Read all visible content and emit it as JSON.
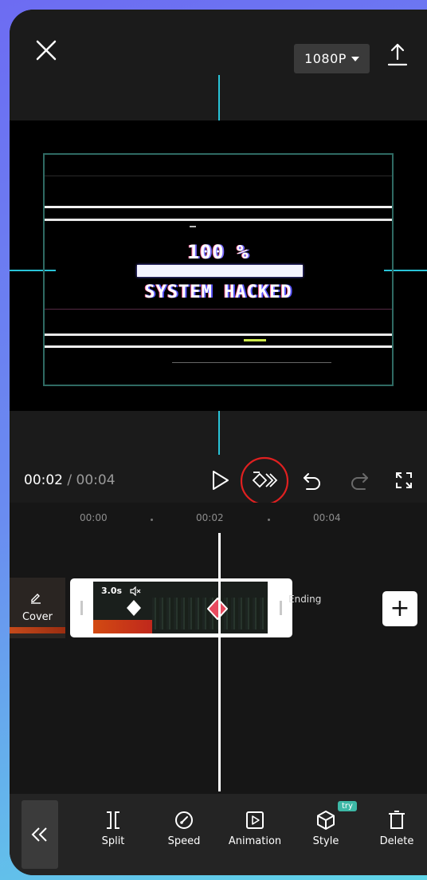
{
  "header": {
    "resolution": "1080P"
  },
  "preview": {
    "percent_text": "100 %",
    "status_text": "SYSTEM HACKED"
  },
  "playback": {
    "current_time": "00:02",
    "separator": " / ",
    "total_time": "00:04"
  },
  "timeline": {
    "ruler_labels": [
      "00:00",
      "00:02",
      "00:04"
    ],
    "cover_label": "Cover",
    "clip_duration": "3.0s",
    "ending_label": "Ending",
    "add_symbol": "+"
  },
  "toolbar": {
    "tools": [
      {
        "label": "Split",
        "icon": "split-icon"
      },
      {
        "label": "Speed",
        "icon": "speed-icon"
      },
      {
        "label": "Animation",
        "icon": "animation-icon"
      },
      {
        "label": "Style",
        "icon": "style-icon"
      },
      {
        "label": "Delete",
        "icon": "delete-icon"
      }
    ],
    "try_badge": "try"
  },
  "colors": {
    "accent_cyan": "#29c4d8",
    "keyframe_red": "#e84a5f",
    "highlight_circle": "#e02020"
  }
}
